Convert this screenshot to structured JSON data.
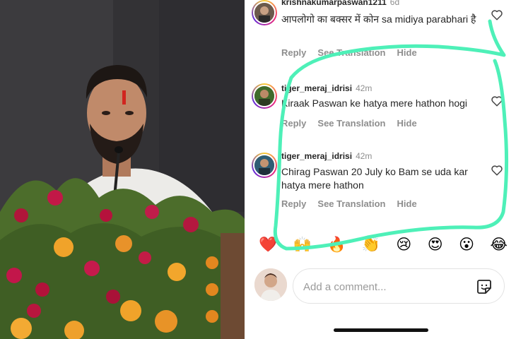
{
  "comments": [
    {
      "username": "krishnakumarpaswan1211",
      "time": "6d",
      "text": "आपलोगो का बक्सर में कोन sa midiya parabhari है",
      "reply_label": "Reply",
      "see_translation_label": "See Translation",
      "hide_label": "Hide"
    },
    {
      "username": "tiger_meraj_idrisi",
      "time": "42m",
      "text": "Kiraak Paswan ke hatya mere hathon hogi",
      "reply_label": "Reply",
      "see_translation_label": "See Translation",
      "hide_label": "Hide"
    },
    {
      "username": "tiger_meraj_idrisi",
      "time": "42m",
      "text": "Chirag Paswan 20 July ko Bam se uda kar hatya mere hathon",
      "reply_label": "Reply",
      "see_translation_label": "See Translation",
      "hide_label": "Hide"
    }
  ],
  "emoji_reactions": [
    "❤️",
    "🙌",
    "🔥",
    "👏",
    "😢",
    "😍",
    "😮",
    "😂"
  ],
  "composer": {
    "placeholder": "Add a comment..."
  },
  "icons": {
    "heart": "heart-outline-icon",
    "sticker": "sticker-icon"
  },
  "colors": {
    "highlight_stroke": "#4ef0b8",
    "secondary_text": "#8e8e8e"
  }
}
